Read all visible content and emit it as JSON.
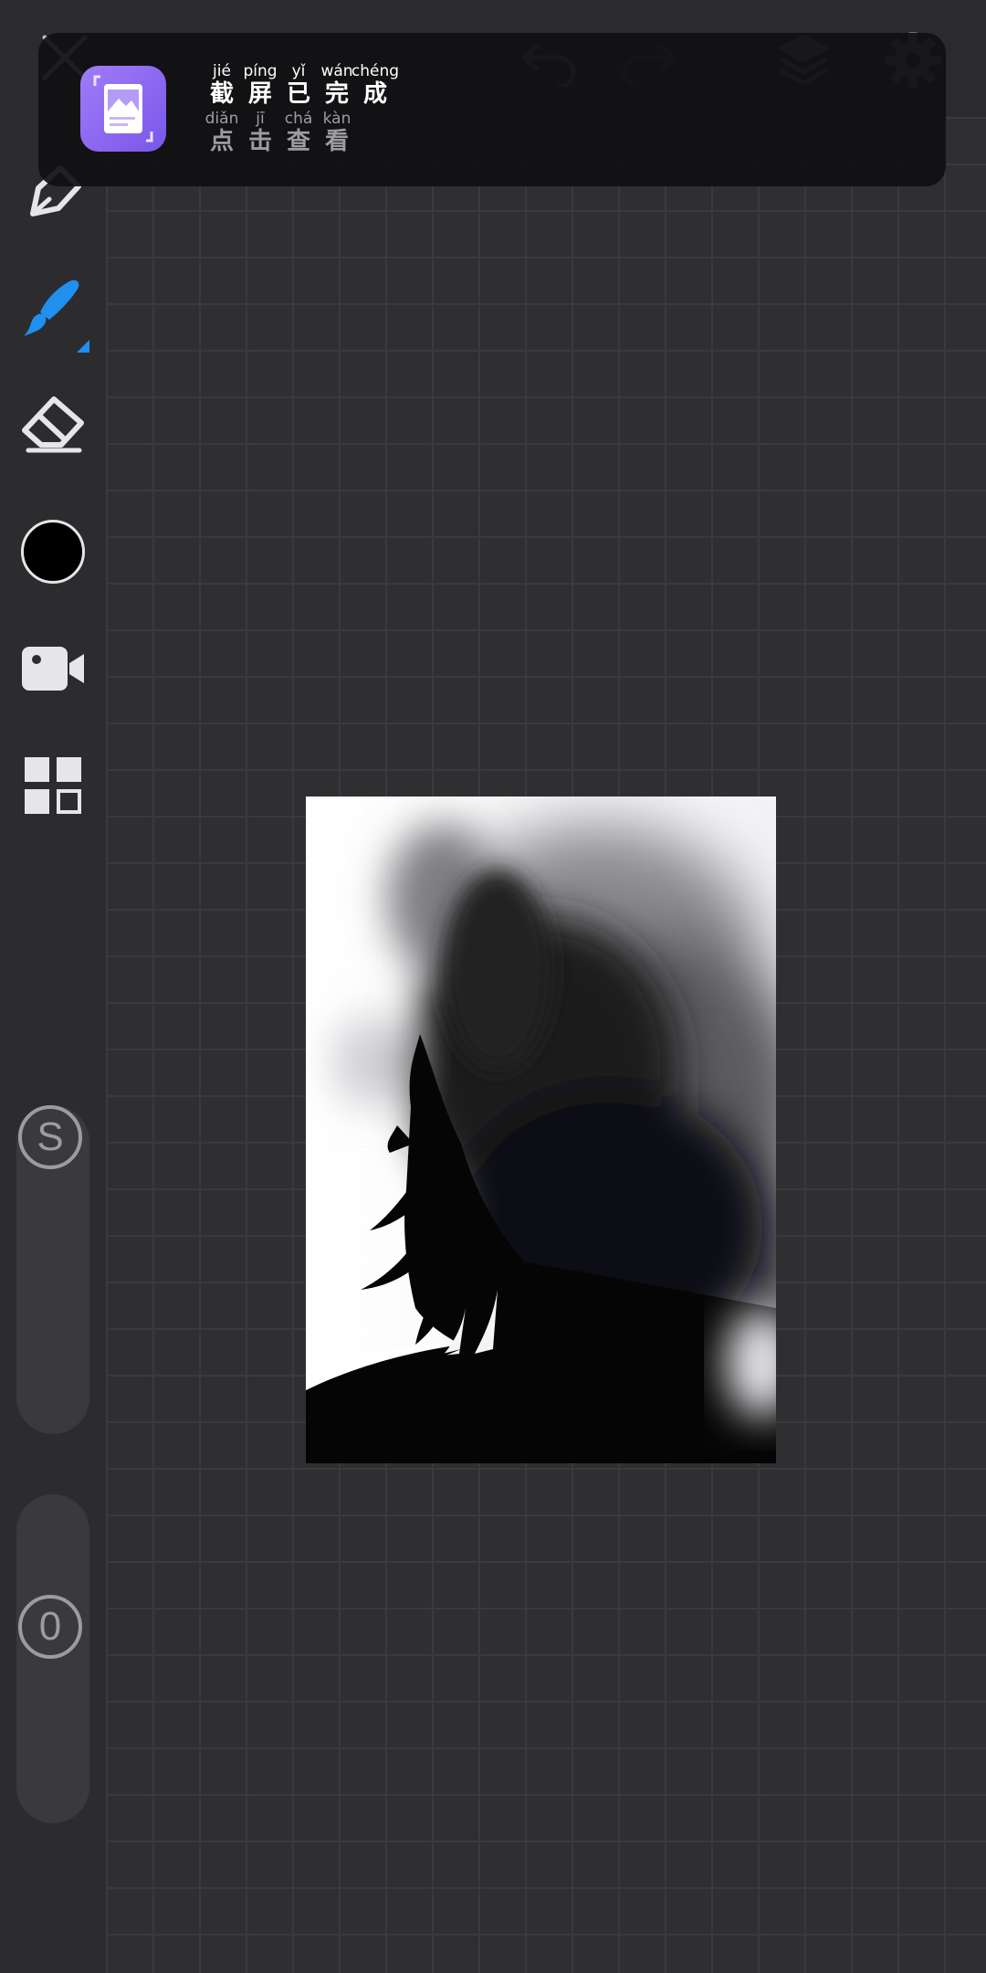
{
  "notification": {
    "title": [
      {
        "pinyin": "jié",
        "char": "截"
      },
      {
        "pinyin": "píng",
        "char": "屏"
      },
      {
        "pinyin": "yǐ",
        "char": "已"
      },
      {
        "pinyin": "wán",
        "char": "完"
      },
      {
        "pinyin": "chéng",
        "char": "成"
      }
    ],
    "subtitle": [
      {
        "pinyin": "diǎn",
        "char": "点"
      },
      {
        "pinyin": "jī",
        "char": "击"
      },
      {
        "pinyin": "chá",
        "char": "查"
      },
      {
        "pinyin": "kàn",
        "char": "看"
      }
    ],
    "icon": "screenshot-gallery-icon"
  },
  "top_toolbar": {
    "icons": [
      "close-icon",
      "undo-icon",
      "redo-icon",
      "layers-icon",
      "settings-icon"
    ]
  },
  "left_toolbar": {
    "tools": [
      "pen-icon",
      "smudge-brush-icon",
      "eraser-icon",
      "color-swatch",
      "video-record-icon",
      "grid-layout-icon"
    ],
    "active_tool": "smudge-brush-icon",
    "current_color": "#000000"
  },
  "size_slider": {
    "label": "S",
    "level": 0.0
  },
  "opacity_slider": {
    "label": "0",
    "level": 0.0
  },
  "colors": {
    "accent": "#1f8ff0",
    "toolbar_bg": "#2c2c2e",
    "canvas_bg": "#2f2f32",
    "notification_icon": "#8b66f0"
  }
}
